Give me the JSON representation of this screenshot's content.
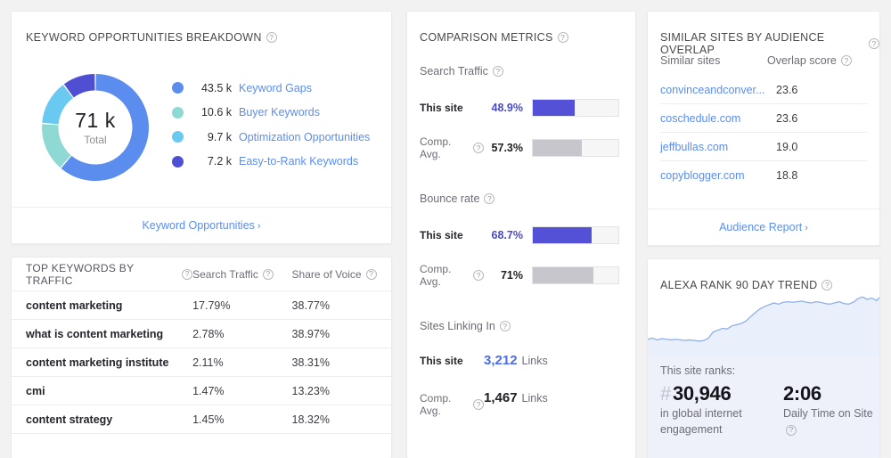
{
  "keyword_breakdown": {
    "title": "KEYWORD OPPORTUNITIES BREAKDOWN",
    "help_icon": "question-mark-icon",
    "total_value": "71 k",
    "total_label": "Total",
    "footer_link": "Keyword Opportunities",
    "footer_chevron": "›",
    "legend": [
      {
        "value": "43.5 k",
        "label": "Keyword Gaps",
        "color": "#5b8def",
        "raw": 43.5
      },
      {
        "value": "10.6 k",
        "label": "Buyer Keywords",
        "color": "#8ed9d4",
        "raw": 10.6
      },
      {
        "value": "9.7 k",
        "label": "Optimization Opportunities",
        "color": "#69c9f0",
        "raw": 9.7
      },
      {
        "value": "7.2 k",
        "label": "Easy-to-Rank Keywords",
        "color": "#4f4fd4",
        "raw": 7.2
      }
    ]
  },
  "top_keywords": {
    "title": "TOP KEYWORDS BY TRAFFIC",
    "columns": [
      "TOP KEYWORDS BY TRAFFIC",
      "Search Traffic",
      "Share of Voice"
    ],
    "rows": [
      {
        "keyword": "content marketing",
        "search_traffic": "17.79%",
        "share_of_voice": "38.77%"
      },
      {
        "keyword": "what is content marketing",
        "search_traffic": "2.78%",
        "share_of_voice": "38.97%"
      },
      {
        "keyword": "content marketing institute",
        "search_traffic": "2.11%",
        "share_of_voice": "38.31%"
      },
      {
        "keyword": "cmi",
        "search_traffic": "1.47%",
        "share_of_voice": "13.23%"
      },
      {
        "keyword": "content strategy",
        "search_traffic": "1.45%",
        "share_of_voice": "18.32%"
      }
    ]
  },
  "comparison_metrics": {
    "title": "COMPARISON METRICS",
    "sections": [
      {
        "name": "Search Traffic",
        "this_site_label": "This site",
        "this_site_value": "48.9%",
        "this_site_pct": 48.9,
        "comp_avg_label": "Comp. Avg.",
        "comp_avg_value": "57.3%",
        "comp_avg_pct": 57.3
      },
      {
        "name": "Bounce rate",
        "this_site_label": "This site",
        "this_site_value": "68.7%",
        "this_site_pct": 68.7,
        "comp_avg_label": "Comp. Avg.",
        "comp_avg_value": "71%",
        "comp_avg_pct": 71
      }
    ],
    "links_section": {
      "name": "Sites Linking In",
      "this_site_label": "This site",
      "this_site_value": "3,212",
      "this_site_unit": "Links",
      "comp_avg_label": "Comp. Avg.",
      "comp_avg_value": "1,467",
      "comp_avg_unit": "Links"
    },
    "accent_color": "#5551d6",
    "neutral_color": "#c6c6cc"
  },
  "similar_sites": {
    "title": "SIMILAR SITES BY AUDIENCE OVERLAP",
    "col_site": "Similar sites",
    "col_score": "Overlap score",
    "rows": [
      {
        "site": "convinceandconver...",
        "score": "23.6"
      },
      {
        "site": "coschedule.com",
        "score": "23.6"
      },
      {
        "site": "jeffbullas.com",
        "score": "19.0"
      },
      {
        "site": "copyblogger.com",
        "score": "18.8"
      }
    ],
    "footer_link": "Audience Report",
    "footer_chevron": "›"
  },
  "alexa_rank": {
    "title": "ALEXA RANK 90 DAY TREND",
    "ranks_label": "This site ranks:",
    "rank_hash": "#",
    "rank_value": "30,946",
    "rank_desc": "in global internet engagement",
    "time_value": "2:06",
    "time_desc": "Daily Time on Site",
    "chart_data": {
      "type": "line",
      "title": "ALEXA RANK 90 DAY TREND",
      "xlabel": "",
      "ylabel": "",
      "grid": false,
      "legend": "none",
      "line_color": "#8fb0ea",
      "fill_color": "#eaf0fb",
      "x": [
        0,
        2,
        4,
        6,
        8,
        10,
        12,
        14,
        16,
        18,
        20,
        22,
        24,
        26,
        28,
        30,
        32,
        34,
        36,
        38,
        40,
        42,
        44,
        46,
        48,
        50,
        52,
        54,
        56,
        58,
        60,
        62,
        64,
        66,
        68,
        70,
        72,
        74,
        76,
        78,
        80,
        82,
        84,
        86,
        88,
        90,
        92,
        94,
        96,
        98,
        100
      ],
      "y": [
        18,
        20,
        17,
        19,
        18,
        17,
        18,
        17,
        16,
        17,
        16,
        15,
        16,
        20,
        30,
        33,
        36,
        35,
        40,
        42,
        44,
        48,
        55,
        62,
        68,
        72,
        75,
        78,
        76,
        79,
        80,
        79,
        80,
        81,
        79,
        78,
        80,
        79,
        77,
        76,
        78,
        80,
        77,
        76,
        79,
        85,
        88,
        84,
        86,
        82,
        90
      ]
    }
  }
}
